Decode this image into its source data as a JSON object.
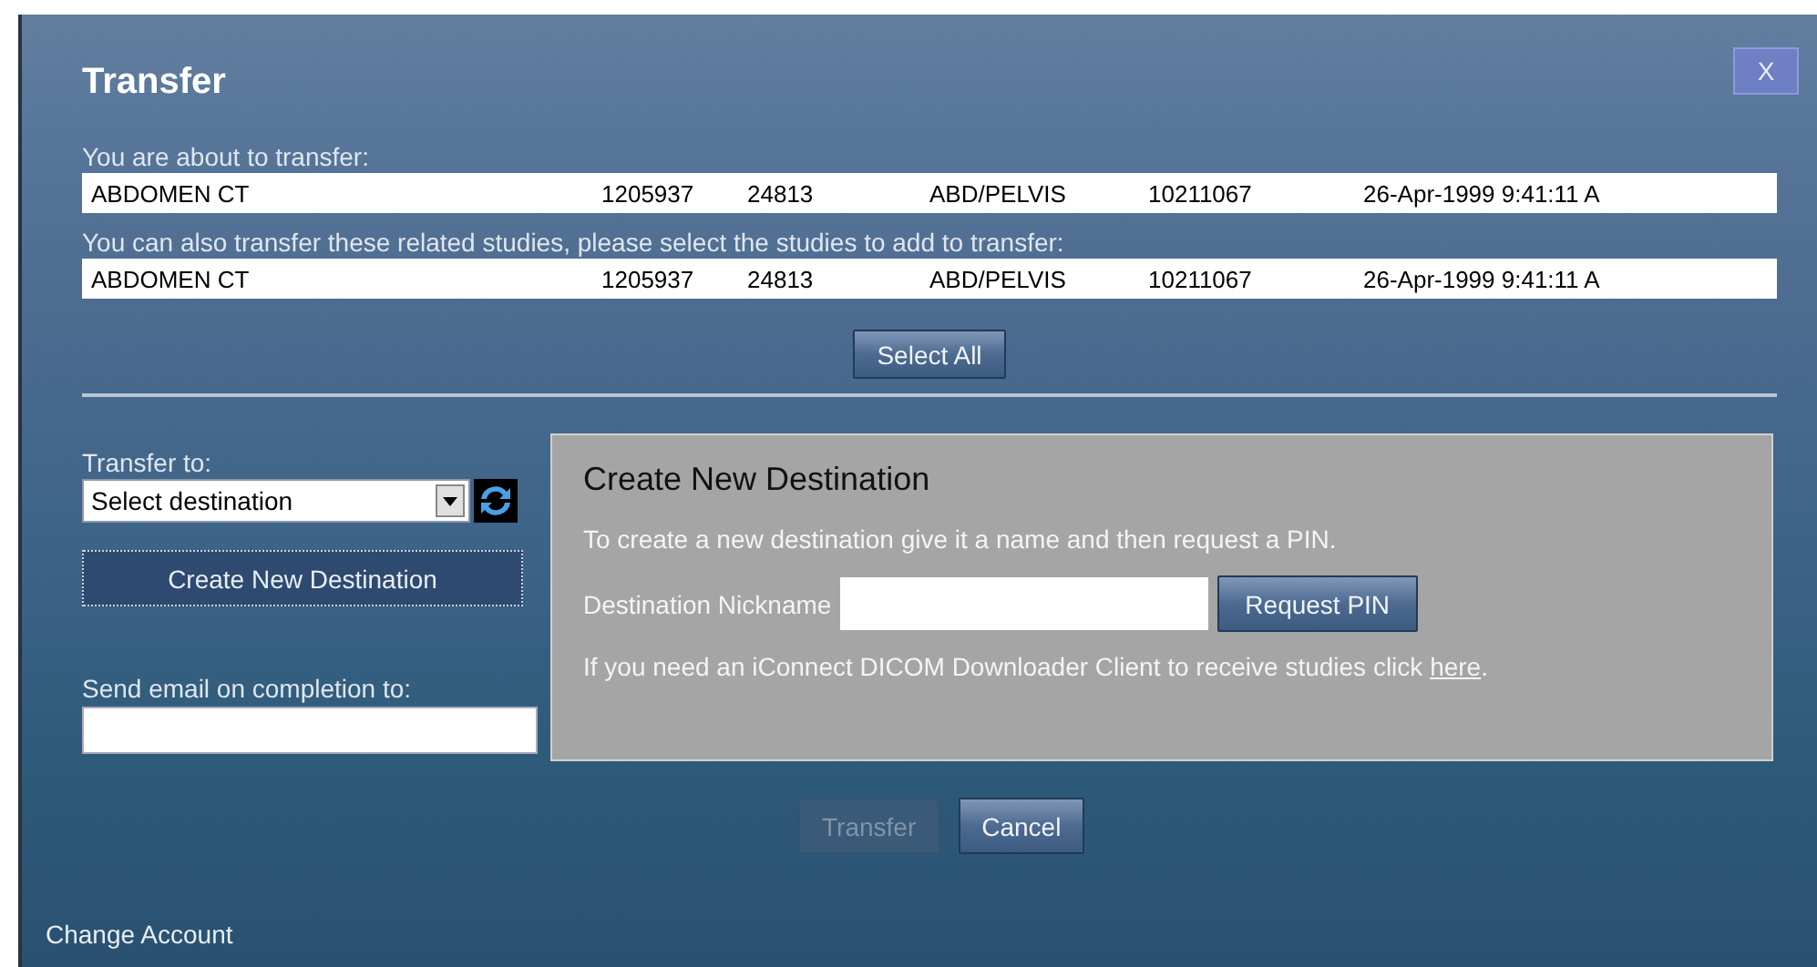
{
  "window": {
    "title": "Transfer",
    "close": "X"
  },
  "current": {
    "label": "You are about to transfer:",
    "studies": [
      {
        "description": "ABDOMEN CT",
        "column_2": "1205937",
        "column_3": "24813",
        "body_part": "ABD/PELVIS",
        "column_5": "10211067",
        "date": "26-Apr-1999 9:41:11 A"
      }
    ]
  },
  "related": {
    "label": "You can also transfer these related studies, please select the studies to add to transfer:",
    "studies": [
      {
        "description": "ABDOMEN CT",
        "column_2": "1205937",
        "column_3": "24813",
        "body_part": "ABD/PELVIS",
        "column_5": "10211067",
        "date": "26-Apr-1999 9:41:11 A"
      }
    ],
    "select_all": "Select All"
  },
  "transfer_to": {
    "label": "Transfer to:",
    "value": "Select destination",
    "create_button": "Create New Destination"
  },
  "email": {
    "label": "Send email on completion to:"
  },
  "create_panel": {
    "title": "Create New Destination",
    "intro": "To create a new destination give it a name and then request a PIN.",
    "nickname_label": "Destination Nickname",
    "request_button": "Request PIN",
    "help_text": "If you need an iConnect DICOM Downloader Client to receive studies click ",
    "help_link": "here",
    "help_suffix": "."
  },
  "buttons": [
    {
      "label": "Transfer",
      "disabled": true
    },
    {
      "label": "Cancel",
      "disabled": false
    }
  ],
  "footer_link": "Change Account"
}
